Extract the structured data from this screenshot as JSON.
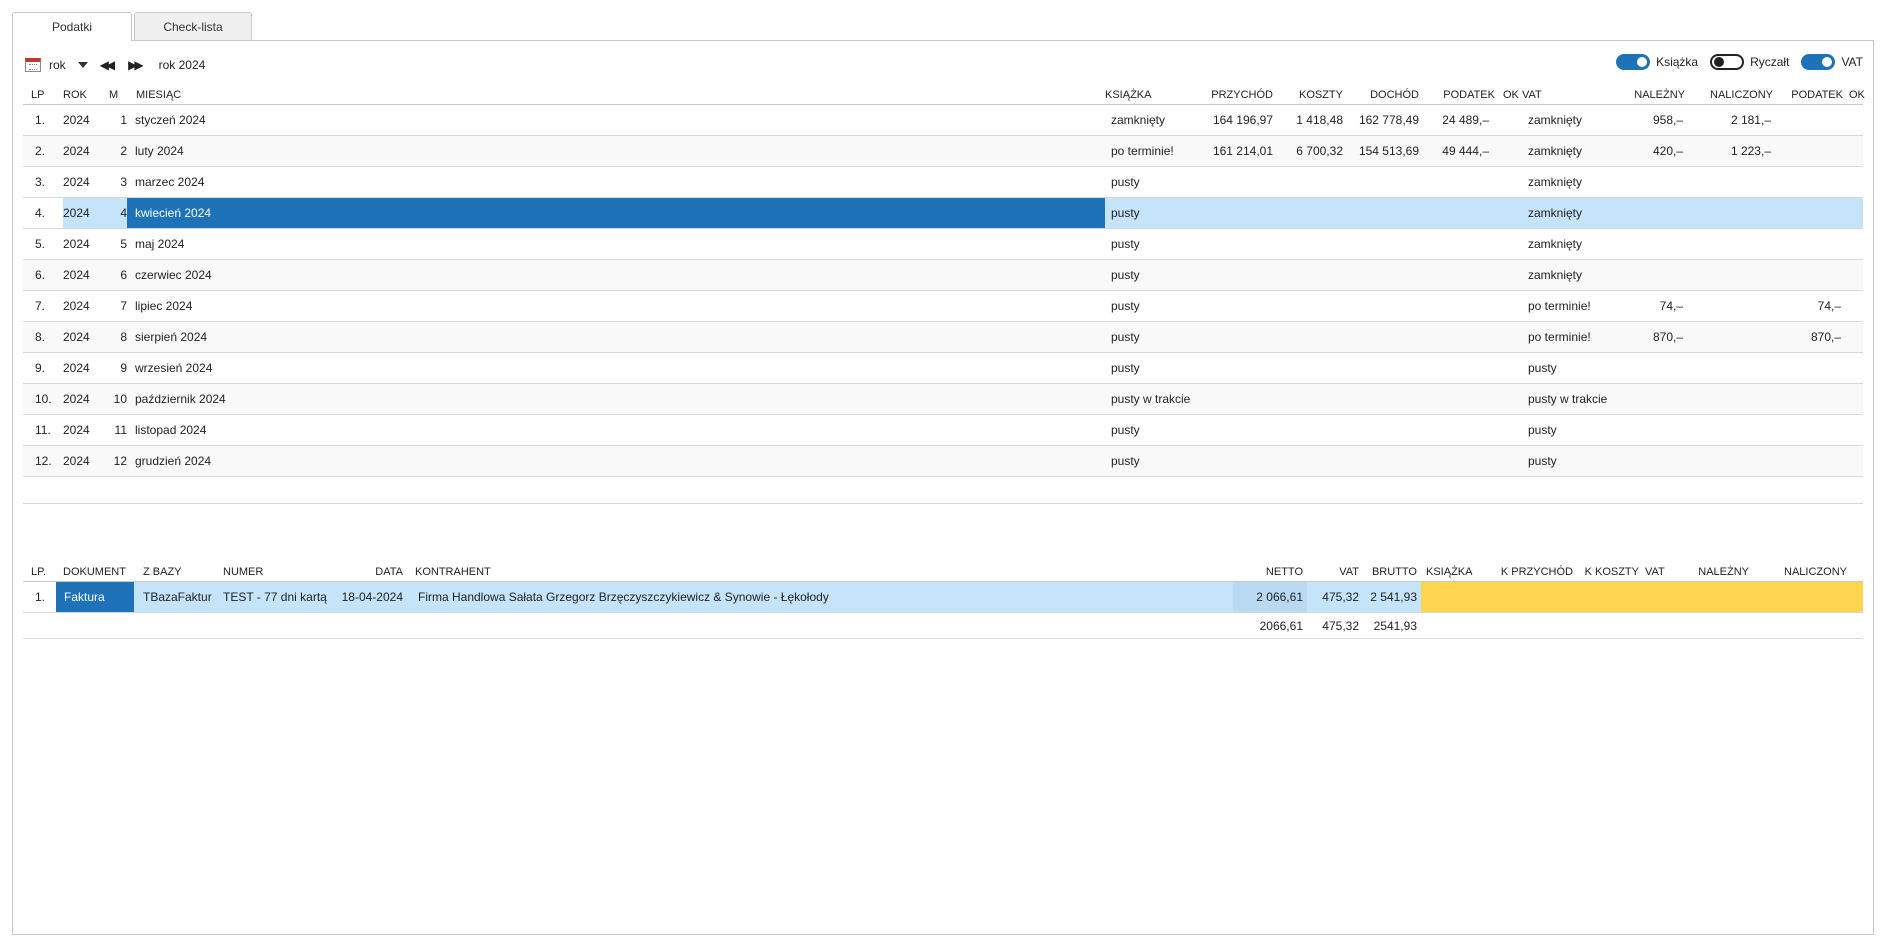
{
  "tabs": [
    {
      "label": "Podatki",
      "active": true
    },
    {
      "label": "Check-lista",
      "active": false
    }
  ],
  "toolbar": {
    "period_label": "rok",
    "year_label": "rok 2024",
    "toggles": [
      {
        "label": "Książka",
        "on": true
      },
      {
        "label": "Ryczałt",
        "on": false
      },
      {
        "label": "VAT",
        "on": true
      }
    ]
  },
  "months_table": {
    "headers": {
      "lp": "LP",
      "rok": "ROK",
      "m": "M",
      "miesiac": "MIESIĄC",
      "ksiazka": "KSIĄŻKA",
      "przychod": "PRZYCHÓD",
      "koszty": "KOSZTY",
      "dochod": "DOCHÓD",
      "podatek": "PODATEK",
      "ok": "OK",
      "vat": "VAT",
      "nalezny": "NALEŻNY",
      "naliczony": "NALICZONY",
      "podatek2": "PODATEK",
      "ok2": "OK"
    },
    "selected_index": 3,
    "rows": [
      {
        "lp": "1.",
        "rok": "2024",
        "m": "1",
        "miesiac": "styczeń 2024",
        "ksiazka": "zamknięty",
        "przychod": "164 196,97",
        "koszty": "1 418,48",
        "dochod": "162 778,49",
        "podatek": "24 489,–",
        "vat": "zamknięty",
        "nalezny": "958,–",
        "naliczony": "2 181,–",
        "podatek2": ""
      },
      {
        "lp": "2.",
        "rok": "2024",
        "m": "2",
        "miesiac": "luty 2024",
        "ksiazka": "po terminie!",
        "przychod": "161 214,01",
        "koszty": "6 700,32",
        "dochod": "154 513,69",
        "podatek": "49 444,–",
        "vat": "zamknięty",
        "nalezny": "420,–",
        "naliczony": "1 223,–",
        "podatek2": ""
      },
      {
        "lp": "3.",
        "rok": "2024",
        "m": "3",
        "miesiac": "marzec 2024",
        "ksiazka": "pusty",
        "przychod": "",
        "koszty": "",
        "dochod": "",
        "podatek": "",
        "vat": "zamknięty",
        "nalezny": "",
        "naliczony": "",
        "podatek2": ""
      },
      {
        "lp": "4.",
        "rok": "2024",
        "m": "4",
        "miesiac": "kwiecień 2024",
        "ksiazka": "pusty",
        "przychod": "",
        "koszty": "",
        "dochod": "",
        "podatek": "",
        "vat": "zamknięty",
        "nalezny": "",
        "naliczony": "",
        "podatek2": ""
      },
      {
        "lp": "5.",
        "rok": "2024",
        "m": "5",
        "miesiac": "maj 2024",
        "ksiazka": "pusty",
        "przychod": "",
        "koszty": "",
        "dochod": "",
        "podatek": "",
        "vat": "zamknięty",
        "nalezny": "",
        "naliczony": "",
        "podatek2": ""
      },
      {
        "lp": "6.",
        "rok": "2024",
        "m": "6",
        "miesiac": "czerwiec 2024",
        "ksiazka": "pusty",
        "przychod": "",
        "koszty": "",
        "dochod": "",
        "podatek": "",
        "vat": "zamknięty",
        "nalezny": "",
        "naliczony": "",
        "podatek2": ""
      },
      {
        "lp": "7.",
        "rok": "2024",
        "m": "7",
        "miesiac": "lipiec 2024",
        "ksiazka": "pusty",
        "przychod": "",
        "koszty": "",
        "dochod": "",
        "podatek": "",
        "vat": "po terminie!",
        "nalezny": "74,–",
        "naliczony": "",
        "podatek2": "74,–"
      },
      {
        "lp": "8.",
        "rok": "2024",
        "m": "8",
        "miesiac": "sierpień 2024",
        "ksiazka": "pusty",
        "przychod": "",
        "koszty": "",
        "dochod": "",
        "podatek": "",
        "vat": "po terminie!",
        "nalezny": "870,–",
        "naliczony": "",
        "podatek2": "870,–"
      },
      {
        "lp": "9.",
        "rok": "2024",
        "m": "9",
        "miesiac": "wrzesień 2024",
        "ksiazka": "pusty",
        "przychod": "",
        "koszty": "",
        "dochod": "",
        "podatek": "",
        "vat": "pusty",
        "nalezny": "",
        "naliczony": "",
        "podatek2": ""
      },
      {
        "lp": "10.",
        "rok": "2024",
        "m": "10",
        "miesiac": "październik 2024",
        "ksiazka": "pusty w trakcie",
        "przychod": "",
        "koszty": "",
        "dochod": "",
        "podatek": "",
        "vat": "pusty w trakcie",
        "nalezny": "",
        "naliczony": "",
        "podatek2": ""
      },
      {
        "lp": "11.",
        "rok": "2024",
        "m": "11",
        "miesiac": "listopad 2024",
        "ksiazka": "pusty",
        "przychod": "",
        "koszty": "",
        "dochod": "",
        "podatek": "",
        "vat": "pusty",
        "nalezny": "",
        "naliczony": "",
        "podatek2": ""
      },
      {
        "lp": "12.",
        "rok": "2024",
        "m": "12",
        "miesiac": "grudzień 2024",
        "ksiazka": "pusty",
        "przychod": "",
        "koszty": "",
        "dochod": "",
        "podatek": "",
        "vat": "pusty",
        "nalezny": "",
        "naliczony": "",
        "podatek2": ""
      }
    ]
  },
  "docs_table": {
    "headers": {
      "lp": "LP.",
      "dokument": "DOKUMENT",
      "z_bazy": "Z BAZY",
      "numer": "NUMER",
      "data": "DATA",
      "kontrahent": "KONTRAHENT",
      "netto": "NETTO",
      "vat": "VAT",
      "brutto": "BRUTTO",
      "ksiazka": "KSIĄŻKA",
      "k_przychod": "K PRZYCHÓD",
      "k_koszty": "K KOSZTY",
      "vat2": "VAT",
      "nalezny": "NALEŻNY",
      "naliczony": "NALICZONY"
    },
    "rows": [
      {
        "lp": "1.",
        "dokument": "Faktura",
        "z_bazy": "TBazaFaktur",
        "numer": "TEST - 77 dni kartą",
        "data": "18-04-2024",
        "kontrahent": "Firma Handlowa Sałata Grzegorz Brzęczyszczykiewicz & Synowie - Łękołody",
        "netto": "2 066,61",
        "vat": "475,32",
        "brutto": "2 541,93"
      }
    ],
    "totals": {
      "netto": "2066,61",
      "vat": "475,32",
      "brutto": "2541,93"
    }
  },
  "colors": {
    "accent": "#1e73b8",
    "selection": "#c5e4f9",
    "highlight": "#ffd54f"
  }
}
